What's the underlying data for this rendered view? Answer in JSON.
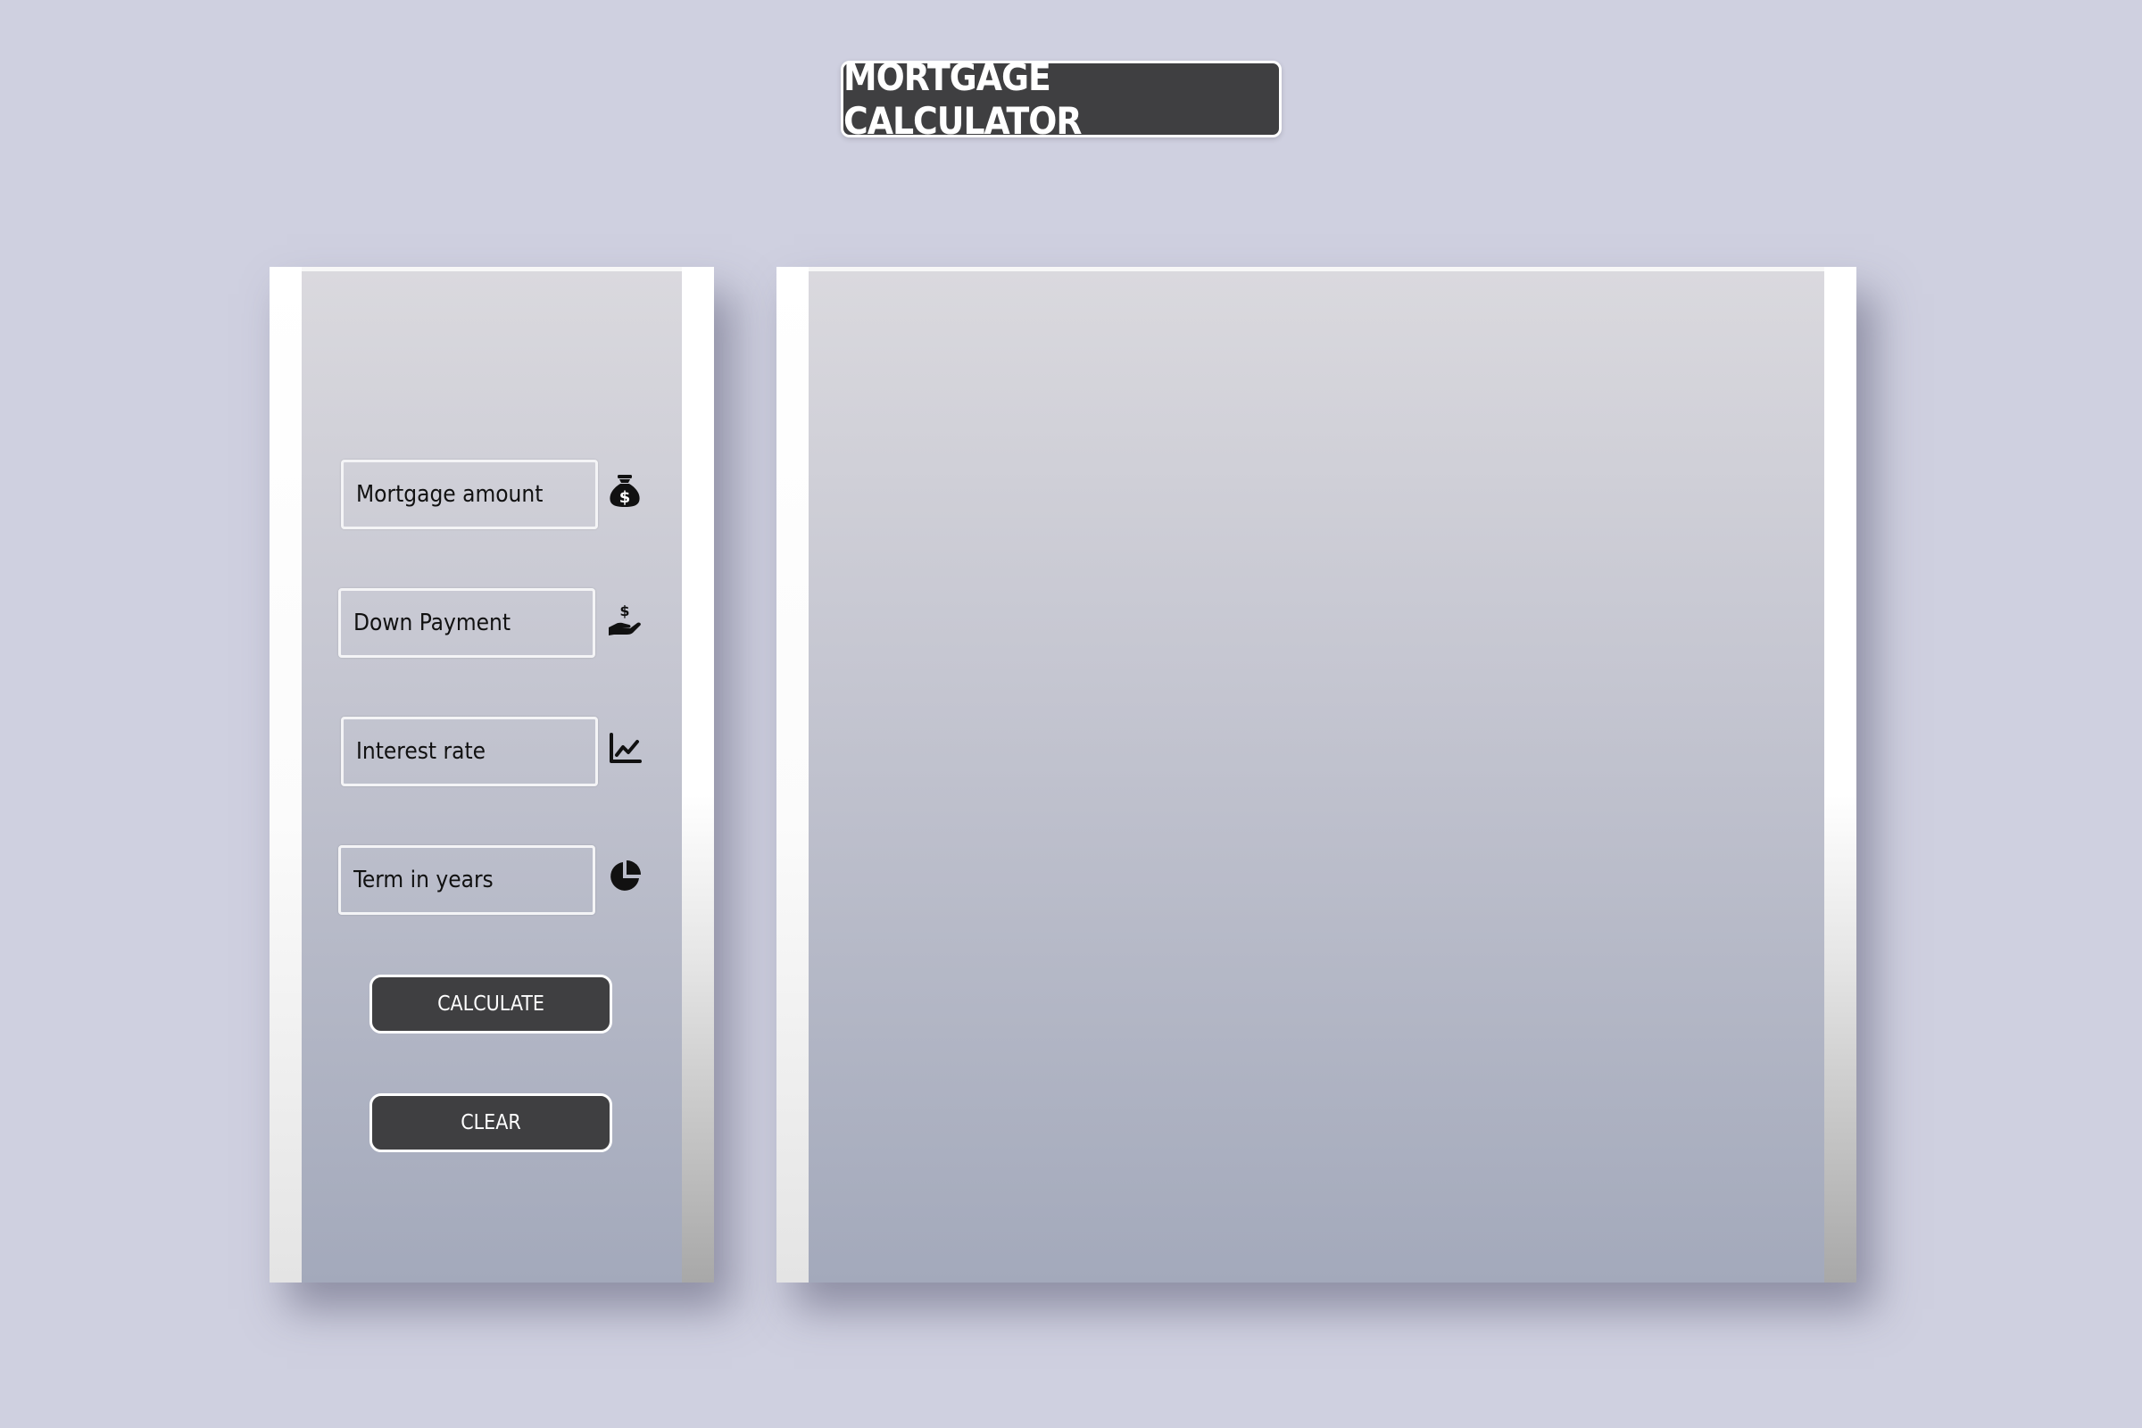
{
  "header": {
    "title": "MORTGAGE CALCULATOR"
  },
  "form": {
    "mortgage_amount": {
      "placeholder": "Mortgage amount",
      "value": "",
      "icon": "money-bag-icon"
    },
    "down_payment": {
      "placeholder": "Down Payment",
      "value": "",
      "icon": "hand-holding-dollar-icon"
    },
    "interest_rate": {
      "placeholder": "Interest rate",
      "value": "",
      "icon": "line-chart-icon"
    },
    "term_years": {
      "placeholder": "Term in years",
      "value": "",
      "icon": "pie-chart-icon"
    },
    "calculate_label": "CALCULATE",
    "clear_label": "CLEAR"
  },
  "results": {
    "content": ""
  },
  "colors": {
    "background": "#cfd0e0",
    "button": "#3f3f41",
    "button_text": "#ffffff",
    "panel_top": "#dad9de",
    "panel_bottom": "#a3a9bb"
  }
}
